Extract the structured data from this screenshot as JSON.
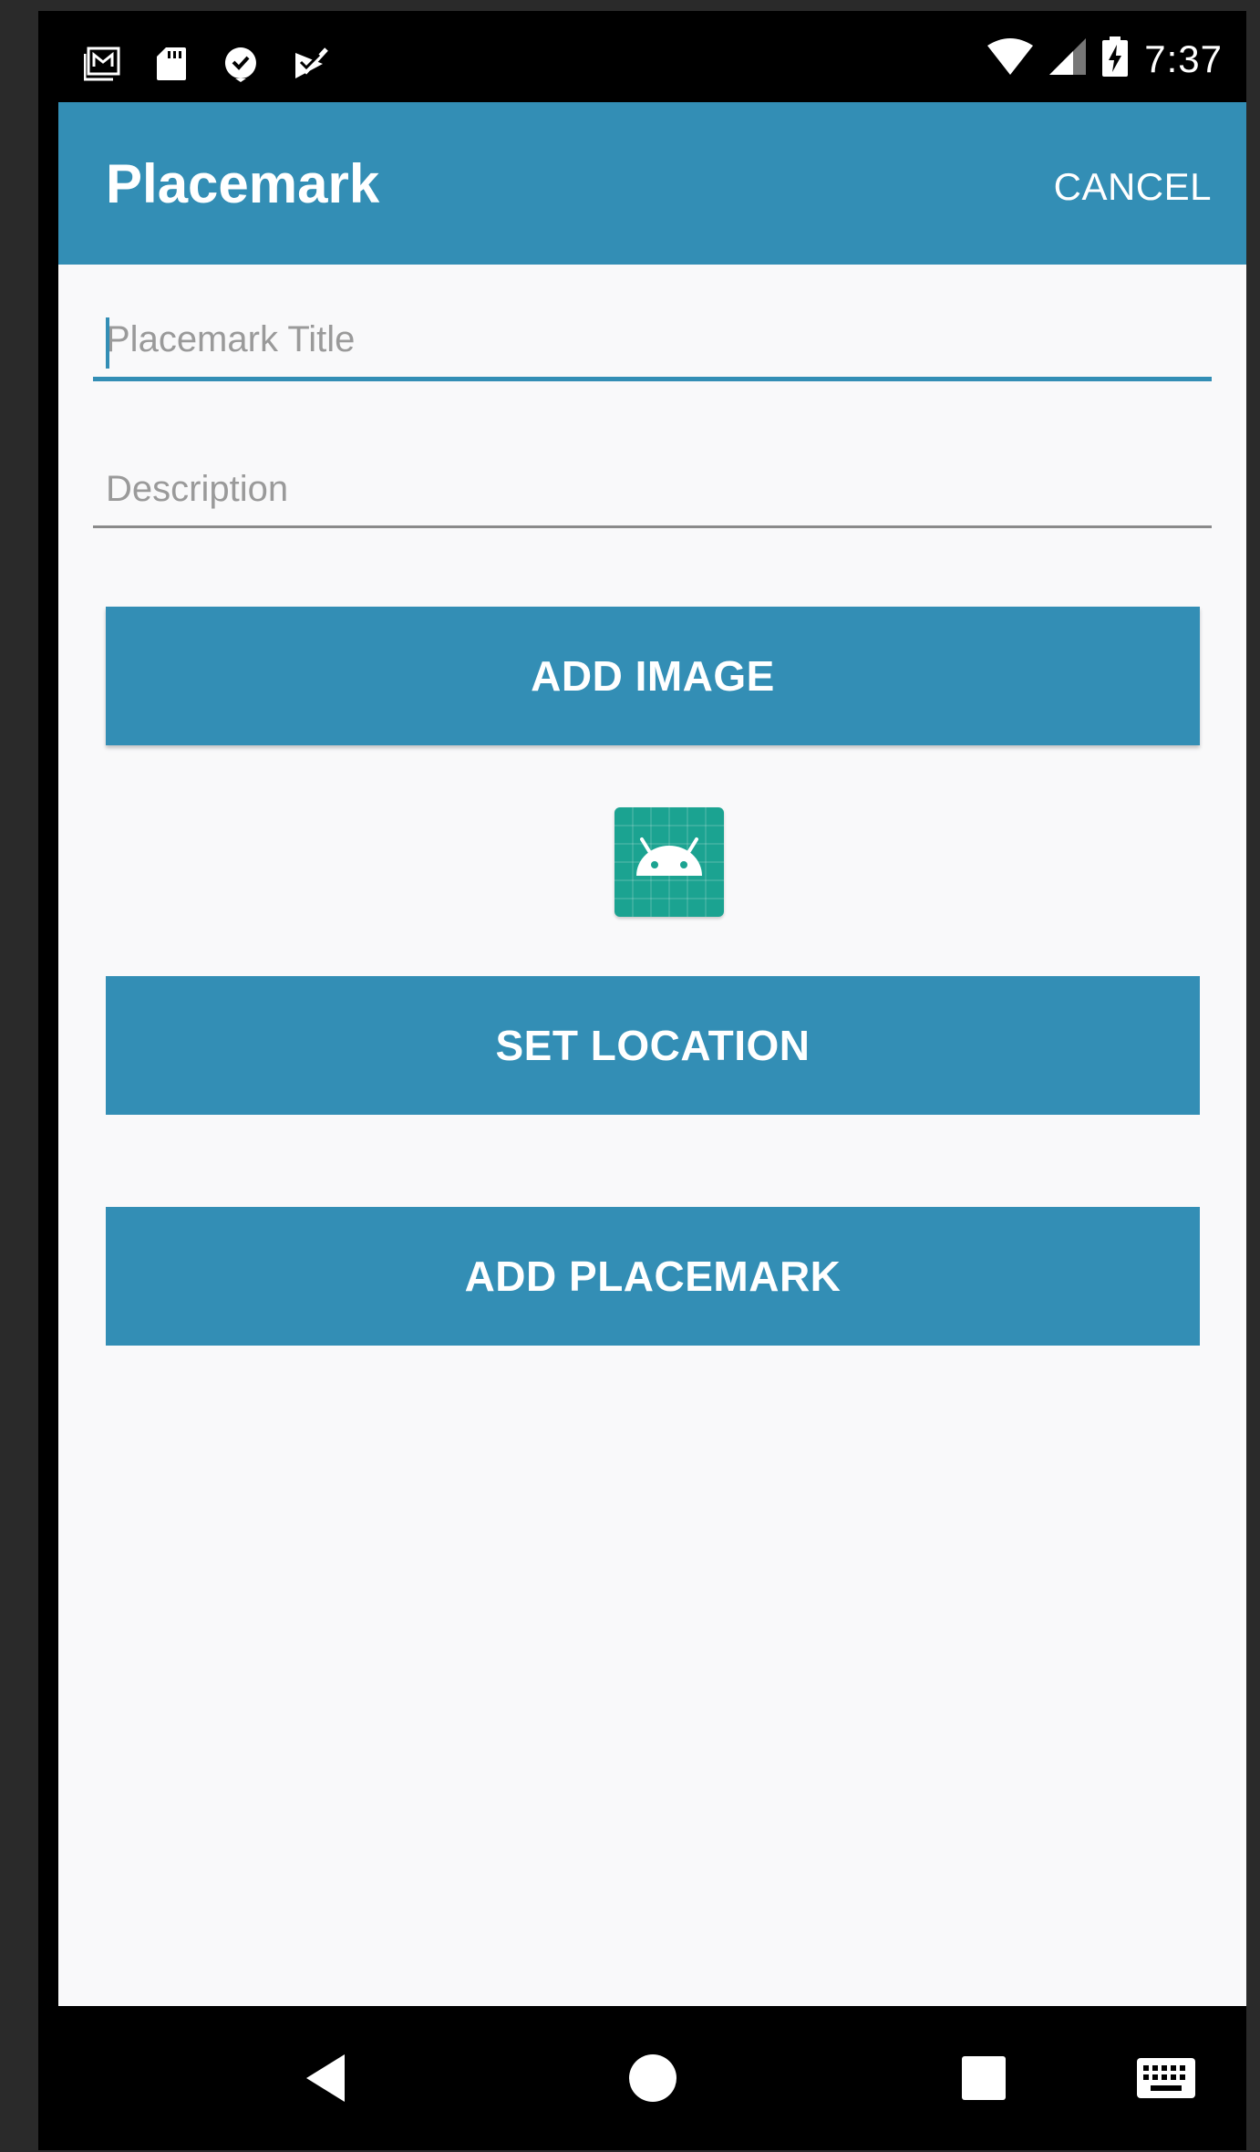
{
  "status_bar": {
    "time": "7:37",
    "left_icons": [
      "gmail-icon",
      "sd-card-icon",
      "notification-icon",
      "check-icon"
    ],
    "right_icons": [
      "wifi-icon",
      "signal-icon",
      "battery-charging-icon"
    ]
  },
  "app_bar": {
    "title": "Placemark",
    "action_label": "CANCEL",
    "color": "#338eb5"
  },
  "form": {
    "title_field": {
      "placeholder": "Placemark Title",
      "value": ""
    },
    "description_field": {
      "placeholder": "Description",
      "value": ""
    },
    "add_image_label": "ADD IMAGE",
    "preview_image_icon": "android-icon",
    "set_location_label": "SET LOCATION",
    "add_placemark_label": "ADD PLACEMARK"
  },
  "nav_bar": {
    "buttons": [
      "back-icon",
      "home-icon",
      "recents-icon",
      "keyboard-icon"
    ]
  }
}
